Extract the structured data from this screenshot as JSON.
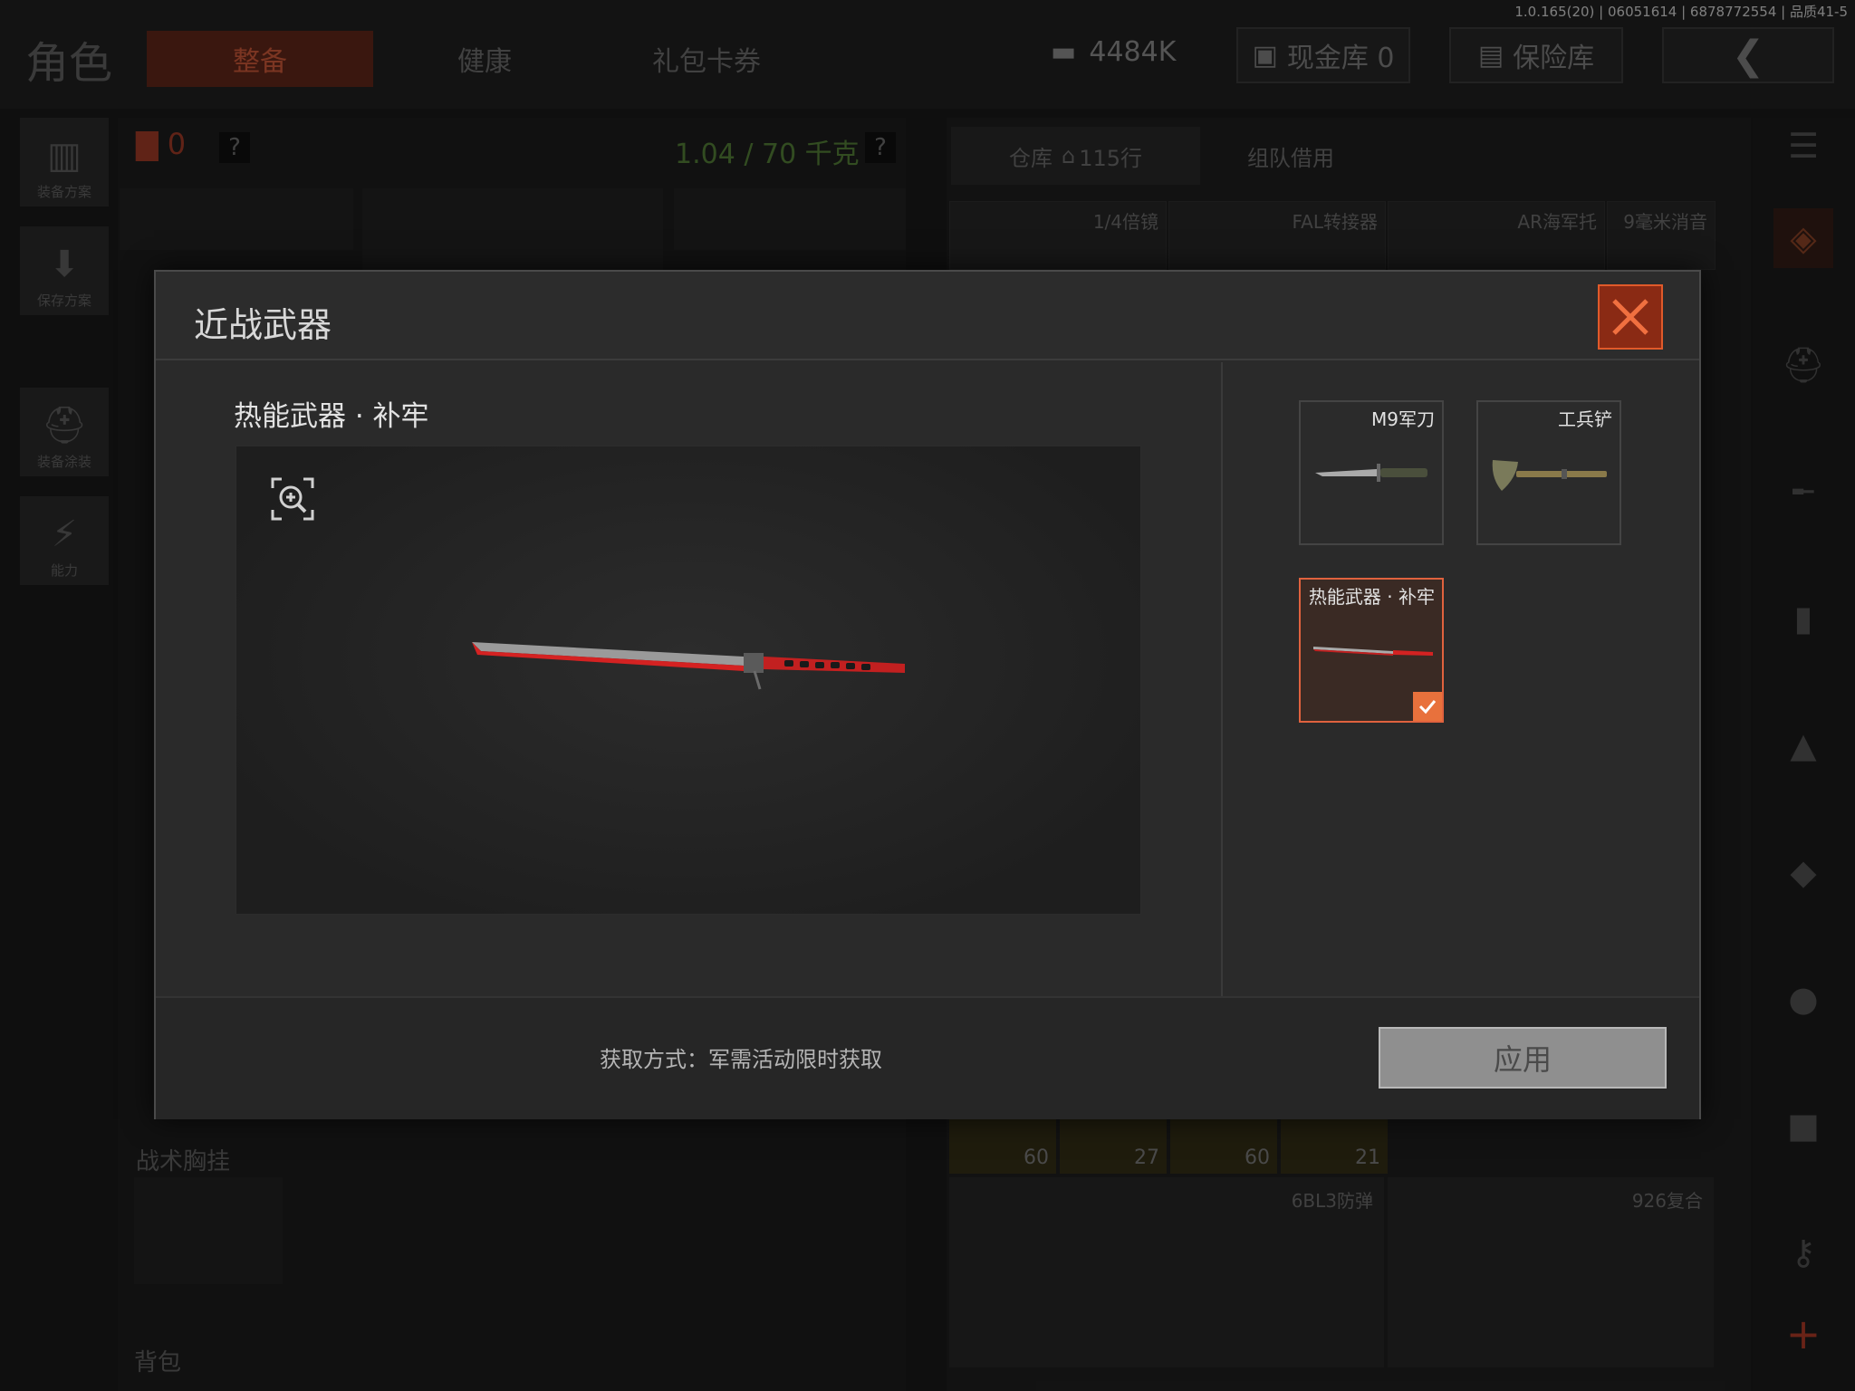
{
  "version": "1.0.165(20) | 06051614 | 6878772554 | 品质41-5",
  "header": {
    "title": "角色",
    "tabs": [
      {
        "label": "整备",
        "active": true
      },
      {
        "label": "健康",
        "active": false
      },
      {
        "label": "礼包卡券",
        "active": false
      }
    ],
    "currency": "4484K",
    "cash_vault": "现金库 0",
    "safe": "保险库"
  },
  "side": {
    "loadout_plan": "装备方案",
    "save_plan": "保存方案",
    "equip_skin": "装备涂装",
    "ability": "能力"
  },
  "left_panel": {
    "backpack_count": "0",
    "weight": "1.04 / 70 千克",
    "rig_label": "战术胸挂",
    "backpack_label": "背包"
  },
  "warehouse": {
    "tab_label": "仓库",
    "rows": "115行",
    "team_tab": "组队借用",
    "cells": [
      "1/4倍镜",
      "FAL转接器",
      "AR海军托",
      "9毫米消音"
    ],
    "ammo": [
      "60",
      "27",
      "60",
      "21"
    ],
    "armor": [
      "6BL3防弹",
      "926复合"
    ]
  },
  "modal": {
    "title": "近战武器",
    "item_name": "热能武器 · 补牢",
    "options": [
      {
        "name": "M9军刀",
        "selected": false
      },
      {
        "name": "工兵铲",
        "selected": false
      },
      {
        "name": "热能武器 · 补牢",
        "selected": true
      }
    ],
    "acquire": "获取方式：军需活动限时获取",
    "apply": "应用"
  },
  "colors": {
    "accent": "#e0623e",
    "close_bg": "#8a2a14",
    "blade_red": "#d42222"
  }
}
